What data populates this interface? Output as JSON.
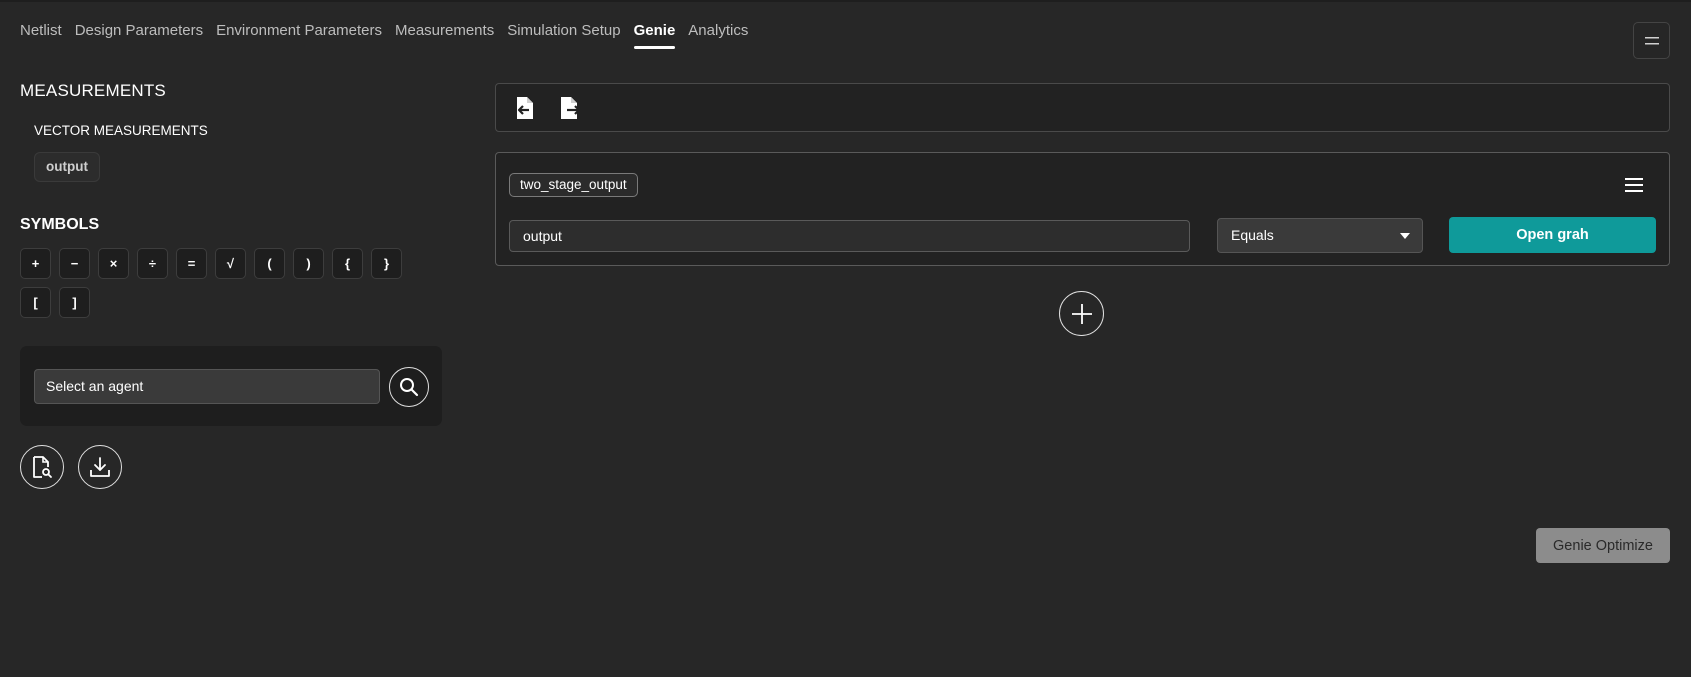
{
  "tabs": [
    {
      "label": "Netlist",
      "active": false
    },
    {
      "label": "Design Parameters",
      "active": false
    },
    {
      "label": "Environment Parameters",
      "active": false
    },
    {
      "label": "Measurements",
      "active": false
    },
    {
      "label": "Simulation Setup",
      "active": false
    },
    {
      "label": "Genie",
      "active": true
    },
    {
      "label": "Analytics",
      "active": false
    }
  ],
  "left": {
    "measurements_heading": "MEASUREMENTS",
    "vector_heading": "VECTOR MEASUREMENTS",
    "vector_items": [
      "output"
    ],
    "symbols_heading": "SYMBOLS",
    "symbols": [
      "+",
      "−",
      "×",
      "÷",
      "=",
      "√",
      "(",
      ")",
      "{",
      "}",
      "[",
      "]"
    ],
    "agent_select": "Select an agent"
  },
  "card": {
    "name": "two_stage_output",
    "measurement_value": "output",
    "condition": "Equals",
    "open_graph_label": "Open grah"
  },
  "genie_optimize_label": "Genie Optimize",
  "colors": {
    "background": "#272727",
    "accent": "#0f9a9a",
    "disabled_button": "#8c8c8c"
  }
}
